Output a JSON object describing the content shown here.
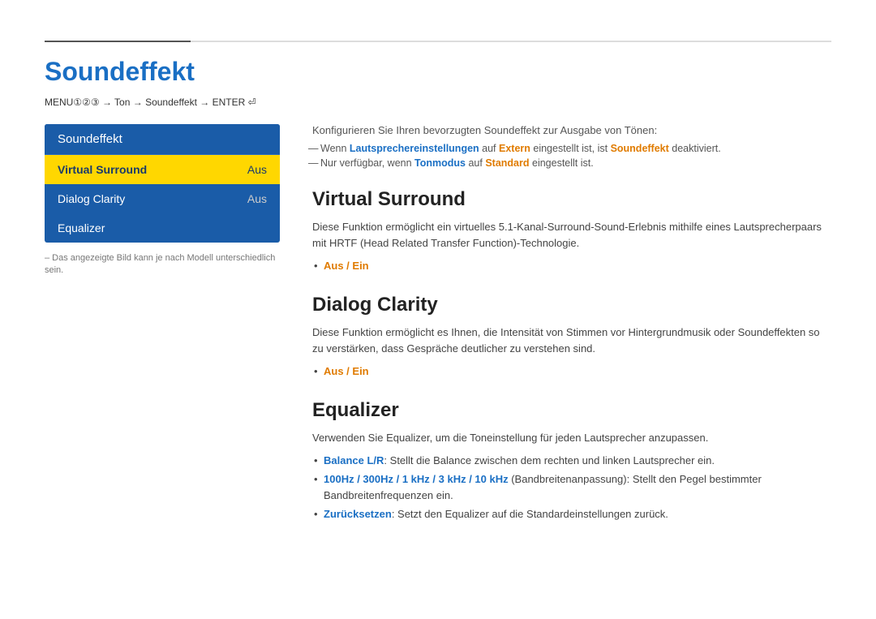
{
  "topBar": {
    "gradientStop": 180
  },
  "page": {
    "title": "Soundeffekt",
    "menuPath": "MENUⅠⅡⅢ → Ton → Soundeffekt → ENTER ↵"
  },
  "sidebar": {
    "header": "Soundeffekt",
    "items": [
      {
        "label": "Virtual Surround",
        "value": "Aus",
        "active": true
      },
      {
        "label": "Dialog Clarity",
        "value": "Aus",
        "active": false
      },
      {
        "label": "Equalizer",
        "value": "",
        "active": false
      }
    ],
    "note": "– Das angezeigte Bild kann je nach Modell unterschiedlich sein."
  },
  "content": {
    "intro": "Konfigurieren Sie Ihren bevorzugten Soundeffekt zur Ausgabe von Tönen:",
    "notes": [
      {
        "id": "note1",
        "parts": [
          {
            "text": "Wenn ",
            "style": "normal"
          },
          {
            "text": "Lautsprechereinstellungen",
            "style": "blue"
          },
          {
            "text": " auf ",
            "style": "normal"
          },
          {
            "text": "Extern",
            "style": "orange"
          },
          {
            "text": " eingestellt ist, ist ",
            "style": "normal"
          },
          {
            "text": "Soundeffekt",
            "style": "orange"
          },
          {
            "text": " deaktiviert.",
            "style": "normal"
          }
        ]
      },
      {
        "id": "note2",
        "parts": [
          {
            "text": "Nur verfügbar, wenn ",
            "style": "normal"
          },
          {
            "text": "Tonmodus",
            "style": "blue"
          },
          {
            "text": " auf ",
            "style": "normal"
          },
          {
            "text": "Standard",
            "style": "orange"
          },
          {
            "text": " eingestellt ist.",
            "style": "normal"
          }
        ]
      }
    ],
    "sections": [
      {
        "id": "virtual-surround",
        "title": "Virtual Surround",
        "desc": "Diese Funktion ermöglicht ein virtuelles 5.1-Kanal-Surround-Sound-Erlebnis mithilfe eines Lautsprecherpaars mit HRTF (Head Related Transfer Function)-Technologie.",
        "bullets": [
          {
            "id": "vs-bullet1",
            "parts": [
              {
                "text": "Aus / Ein",
                "style": "orange"
              }
            ]
          }
        ]
      },
      {
        "id": "dialog-clarity",
        "title": "Dialog Clarity",
        "desc": "Diese Funktion ermöglicht es Ihnen, die Intensität von Stimmen vor Hintergrundmusik oder Soundeffekten so zu verstärken, dass Gespräche deutlicher zu verstehen sind.",
        "bullets": [
          {
            "id": "dc-bullet1",
            "parts": [
              {
                "text": "Aus / Ein",
                "style": "orange"
              }
            ]
          }
        ]
      },
      {
        "id": "equalizer",
        "title": "Equalizer",
        "intro_parts": [
          {
            "text": "Verwenden Sie ",
            "style": "normal"
          },
          {
            "text": "Equalizer",
            "style": "blue"
          },
          {
            "text": ", um die Toneinstellung für jeden Lautsprecher anzupassen.",
            "style": "normal"
          }
        ],
        "bullets": [
          {
            "id": "eq-bullet1",
            "parts": [
              {
                "text": "Balance L/R",
                "style": "blue"
              },
              {
                "text": ": Stellt die Balance zwischen dem rechten und linken Lautsprecher ein.",
                "style": "normal"
              }
            ]
          },
          {
            "id": "eq-bullet2",
            "parts": [
              {
                "text": "100Hz / 300Hz / 1 kHz / 3 kHz / 10 kHz",
                "style": "blue"
              },
              {
                "text": " (Bandbreitenanpassung): Stellt den Pegel bestimmter Bandbreitenfrequenzen ein.",
                "style": "normal"
              }
            ]
          },
          {
            "id": "eq-bullet3",
            "parts": [
              {
                "text": "Zurücksetzen",
                "style": "blue"
              },
              {
                "text": ": Setzt den Equalizer auf die Standardeinstellungen zurück.",
                "style": "normal"
              }
            ]
          }
        ]
      }
    ]
  }
}
